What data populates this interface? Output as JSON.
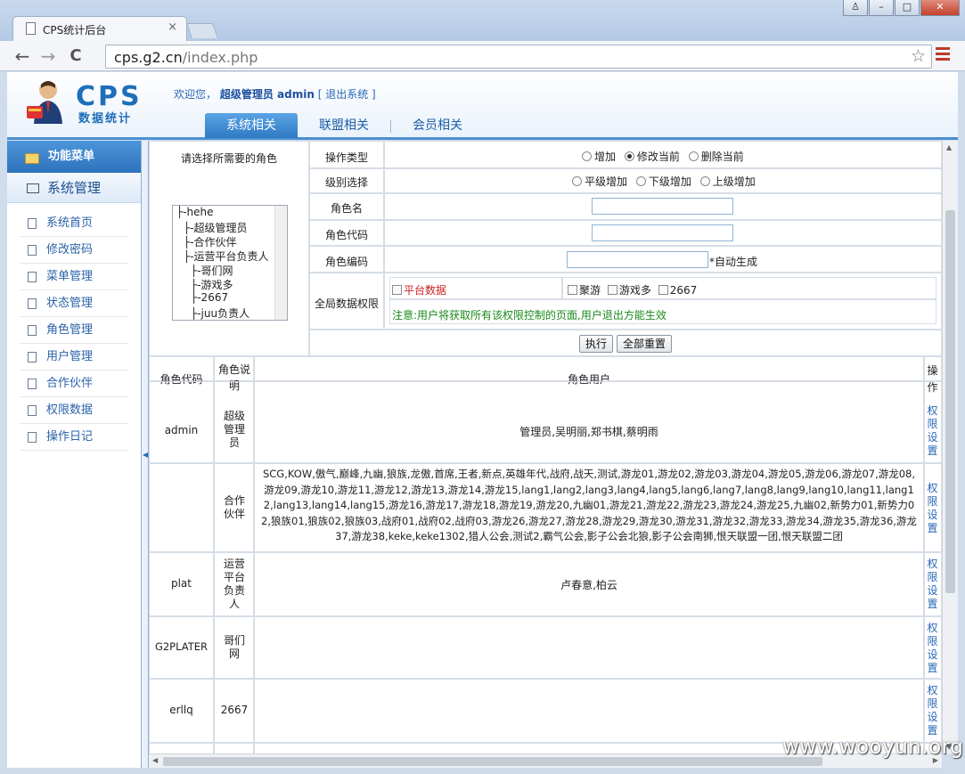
{
  "browser": {
    "tab_title": "CPS统计后台",
    "tab_close": "×",
    "url_host": "cps.g2.cn",
    "url_path": "/index.php",
    "back": "←",
    "forward": "→",
    "reload": "C",
    "star": "☆",
    "window_buttons": [
      "♙",
      "–",
      "□",
      "✕"
    ]
  },
  "header": {
    "logo_text": "CPS",
    "logo_sub": "数据统计",
    "welcome_prefix": "欢迎您，",
    "user": "超级管理员 admin",
    "logout": "[ 退出系统 ]",
    "nav": [
      "系统相关",
      "联盟相关",
      "会员相关"
    ]
  },
  "sidebar": {
    "title": "功能菜单",
    "section": "系统管理",
    "items": [
      "系统首页",
      "修改密码",
      "菜单管理",
      "状态管理",
      "角色管理",
      "用户管理",
      "合作伙伴",
      "权限数据",
      "操作日记"
    ]
  },
  "form": {
    "pick_role_label": "请选择所需要的角色",
    "tree": [
      "├-hehe",
      "├-超级管理员",
      "├-合作伙伴",
      "├-运营平台负责人",
      "├-哥们网",
      "├-游戏多",
      "├-2667",
      "├-juu负责人"
    ],
    "op_type_label": "操作类型",
    "op_types": [
      "增加",
      "修改当前",
      "删除当前"
    ],
    "level_label": "级别选择",
    "levels": [
      "平级增加",
      "下级增加",
      "上级增加"
    ],
    "role_name_label": "角色名",
    "role_code_label": "角色代码",
    "role_num_label": "角色编码",
    "auto_gen": "*自动生成",
    "global_perm_label": "全局数据权限",
    "platform_data": "平台数据",
    "perm_options": [
      "聚游",
      "游戏多",
      "2667"
    ],
    "notice": "注意:用户将获取所有该权限控制的页面,用户退出方能生效",
    "execute": "执行",
    "reset": "全部重置"
  },
  "table": {
    "headers": [
      "角色代码",
      "角色说明",
      "角色用户",
      "操作"
    ],
    "rows": [
      {
        "code": "admin",
        "desc": "超级管理员",
        "users": "管理员,吴明丽,郑书棋,蔡明雨",
        "action": "权限设置"
      },
      {
        "code": "",
        "desc": "合作伙伴",
        "users": "SCG,KOW,傲气,巅峰,九幽,狼族,龙傲,首席,王者,新点,英雄年代,战府,战天,测试,游龙01,游龙02,游龙03,游龙04,游龙05,游龙06,游龙07,游龙08,游龙09,游龙10,游龙11,游龙12,游龙13,游龙14,游龙15,lang1,lang2,lang3,lang4,lang5,lang6,lang7,lang8,lang9,lang10,lang11,lang12,lang13,lang14,lang15,游龙16,游龙17,游龙18,游龙19,游龙20,九幽01,游龙21,游龙22,游龙23,游龙24,游龙25,九幽02,新势力01,新势力02,狼族01,狼族02,狼族03,战府01,战府02,战府03,游龙26,游龙27,游龙28,游龙29,游龙30,游龙31,游龙32,游龙33,游龙34,游龙35,游龙36,游龙37,游龙38,keke,keke1302,猎人公会,测试2,霸气公会,影子公会北狼,影子公会南狮,恨天联盟一团,恨天联盟二团",
        "action": "权限设置"
      },
      {
        "code": "plat",
        "desc": "运营平台负责人",
        "users": "卢春意,柏云",
        "action": "权限设置"
      },
      {
        "code": "G2PLATER",
        "desc": "哥们网",
        "users": "",
        "action": "权限设置"
      },
      {
        "code": "erllq",
        "desc": "2667",
        "users": "",
        "action": "权限设置"
      }
    ]
  },
  "watermark": "www.wooyun.org",
  "colors": {
    "accent": "#2e7ac4",
    "link": "#2a68b6",
    "notice": "#1a8a1a",
    "platform": "#cc2222"
  }
}
